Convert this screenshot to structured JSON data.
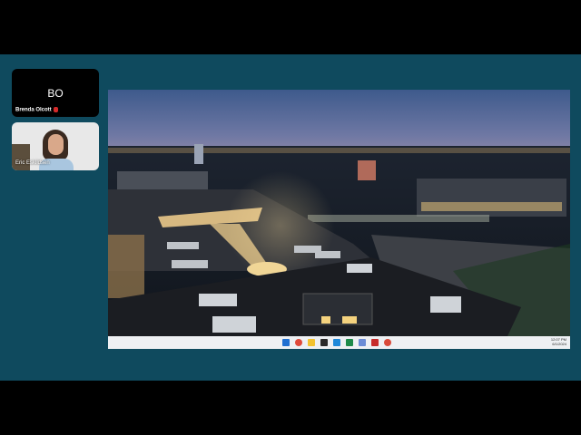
{
  "participants": [
    {
      "initials": "BO",
      "name": "Brenda Olcott",
      "muted": true
    },
    {
      "name": "Eric Eskildsen"
    }
  ],
  "taskbar": {
    "icons": [
      "windows-start-icon",
      "chrome-icon",
      "file-explorer-icon",
      "terminal-icon",
      "vscode-icon",
      "excel-icon",
      "paint-icon",
      "filezilla-icon",
      "app-icon"
    ],
    "clock": {
      "time": "12:07 PM",
      "date": "6/1/2024"
    }
  },
  "colors": {
    "meeting_bg": "#0f4a5e",
    "letterbox": "#000000",
    "muted_mic": "#d42a2a"
  }
}
